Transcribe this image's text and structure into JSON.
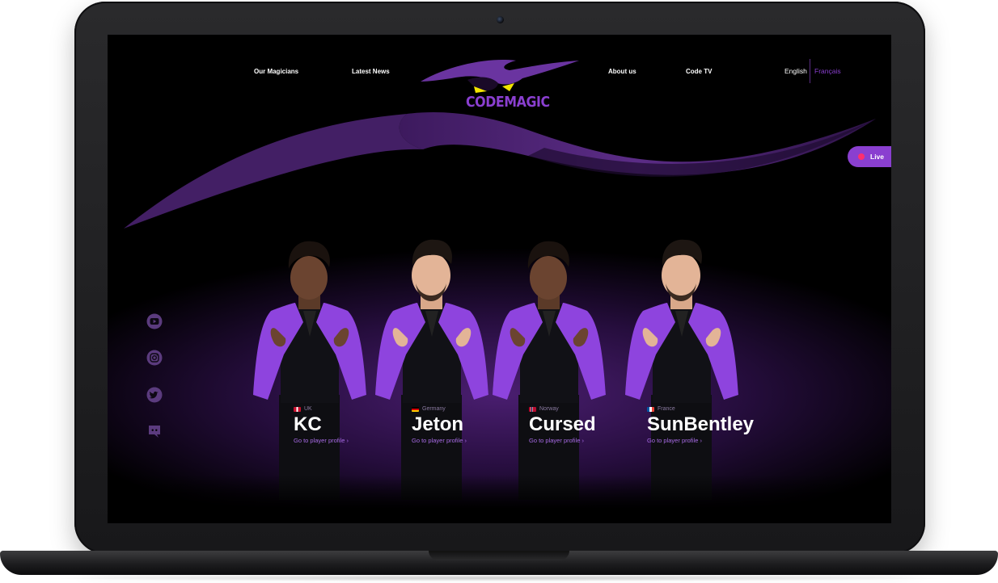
{
  "nav": {
    "left": [
      "Our Magicians",
      "Latest News"
    ],
    "right": [
      "About us",
      "Code TV"
    ]
  },
  "brand": {
    "name": "CODEMAGIC"
  },
  "languages": {
    "current": "English",
    "other": "Français"
  },
  "live": {
    "label": "Live"
  },
  "social": [
    "youtube-icon",
    "instagram-icon",
    "twitter-icon",
    "discord-icon"
  ],
  "players": [
    {
      "country": "UK",
      "name": "KC",
      "link": "Go to player profile"
    },
    {
      "country": "Germany",
      "name": "Jeton",
      "link": "Go to player profile"
    },
    {
      "country": "Norway",
      "name": "Cursed",
      "link": "Go to player profile"
    },
    {
      "country": "France",
      "name": "SunBentley",
      "link": "Go to player profile"
    }
  ],
  "colors": {
    "accent": "#8a3fd0",
    "live_dot": "#ff2f6e",
    "background": "#000000"
  }
}
